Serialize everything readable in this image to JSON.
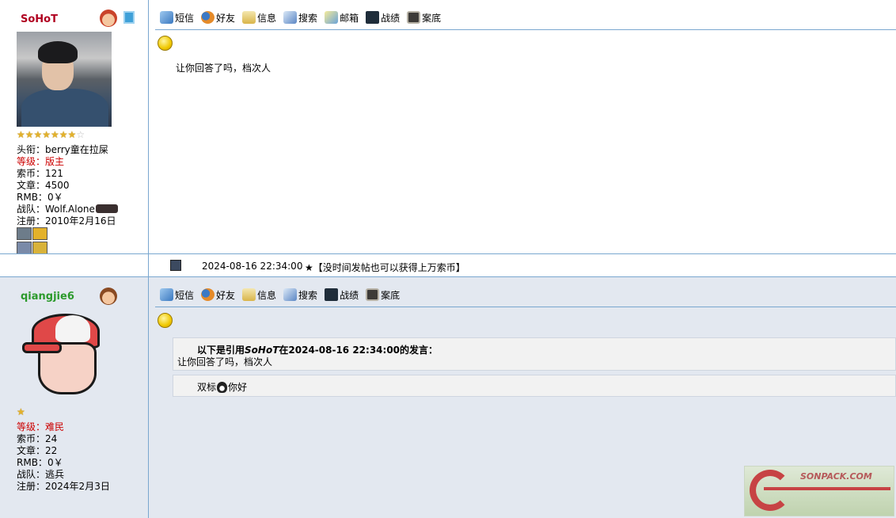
{
  "toolbar_full": [
    {
      "label": "短信",
      "icon": "message-icon"
    },
    {
      "label": "好友",
      "icon": "friends-icon"
    },
    {
      "label": "信息",
      "icon": "info-icon"
    },
    {
      "label": "搜索",
      "icon": "search-icon"
    },
    {
      "label": "邮箱",
      "icon": "mail-icon"
    },
    {
      "label": "战绩",
      "icon": "record-icon"
    },
    {
      "label": "案底",
      "icon": "case-icon"
    }
  ],
  "toolbar_short": [
    {
      "label": "短信",
      "icon": "message-icon"
    },
    {
      "label": "好友",
      "icon": "friends-icon"
    },
    {
      "label": "信息",
      "icon": "info-icon"
    },
    {
      "label": "搜索",
      "icon": "search-icon"
    },
    {
      "label": "战绩",
      "icon": "record-icon"
    },
    {
      "label": "案底",
      "icon": "case-icon"
    }
  ],
  "post1": {
    "username": "SoHoT",
    "stars_on": 7,
    "stars_total": 8,
    "info": [
      {
        "label": "头衔：",
        "value": "berry童在拉屎"
      },
      {
        "label": "等级：",
        "value": "版主"
      },
      {
        "label": "索币：",
        "value": "121"
      },
      {
        "label": "文章：",
        "value": "4500"
      },
      {
        "label": "RMB：",
        "value": "0￥"
      },
      {
        "label": "战队：",
        "value": "Wolf.Alone"
      },
      {
        "label": "注册：",
        "value": "2010年2月16日"
      }
    ],
    "content": "让你回答了吗，档次人",
    "footer_time": "2024-08-16 22:34:00",
    "footer_signature": "★【没时间发帖也可以获得上万索币】"
  },
  "post2": {
    "username": "qiangjie6",
    "stars_on": 1,
    "info": [
      {
        "label": "等级：",
        "value": "难民"
      },
      {
        "label": "索币：",
        "value": "24"
      },
      {
        "label": "文章：",
        "value": "22"
      },
      {
        "label": "RMB：",
        "value": "0￥"
      },
      {
        "label": "战队：",
        "value": "逃兵"
      },
      {
        "label": "注册：",
        "value": "2024年2月3日"
      }
    ],
    "quote": {
      "prefix": "以下是引用",
      "author": "SoHoT",
      "middle": "在",
      "time": "2024-08-16 22:34:00",
      "suffix": "的发言：",
      "body": "让你回答了吗，档次人"
    },
    "reply_before": "双标",
    "reply_after": "你好"
  },
  "colors": {
    "accent_line": "#7aa7cf",
    "post2_bg": "#e3e8f0",
    "username_red": "#b00020",
    "username_green": "#2c9a2c",
    "level_red": "#cc0000"
  },
  "watermark_text": "SONPACK.COM"
}
